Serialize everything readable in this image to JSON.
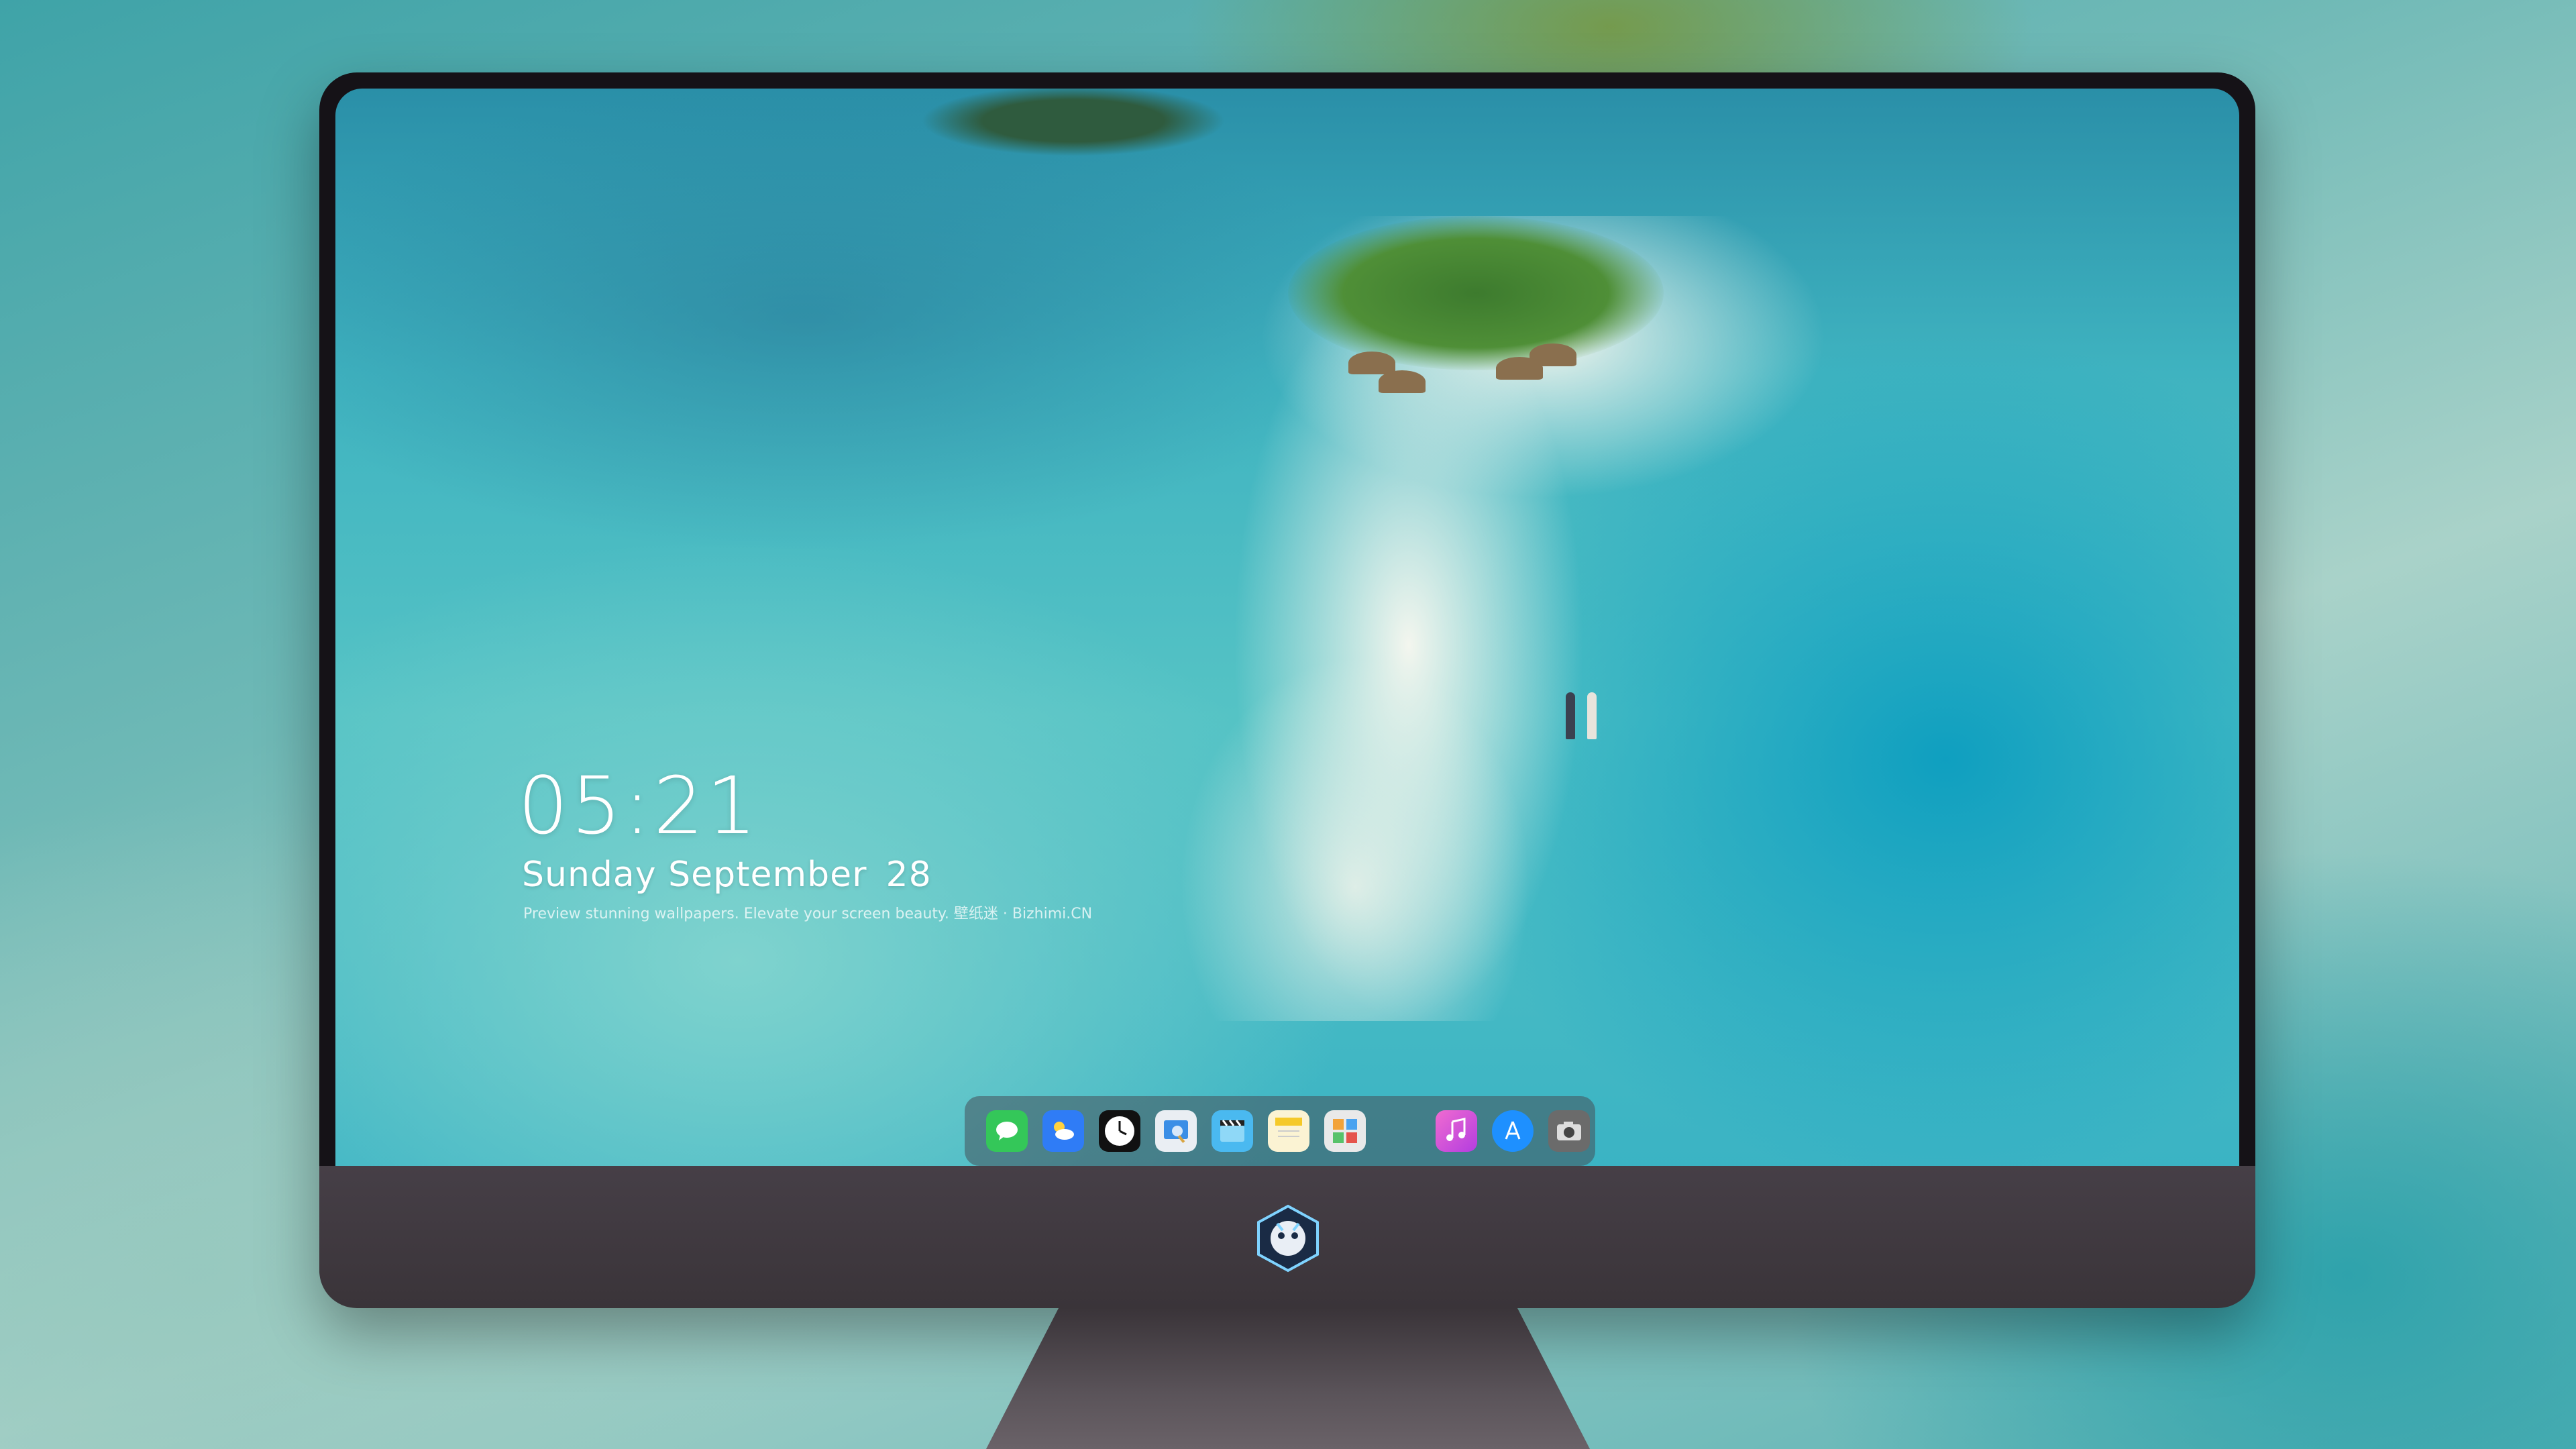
{
  "lockscreen": {
    "time": "05:21",
    "weekday_month": "Sunday September",
    "day": "28",
    "tagline": "Preview stunning wallpapers. Elevate your screen beauty. 壁纸迷 · Bizhimi.CN"
  },
  "dock": {
    "apps": [
      {
        "name": "messages",
        "icon": "speech-bubble",
        "color": "#34c759"
      },
      {
        "name": "weather",
        "icon": "cloud",
        "color": "#2f7cf6"
      },
      {
        "name": "clock",
        "icon": "clock",
        "color": "#111111"
      },
      {
        "name": "preview",
        "icon": "photo-viewer",
        "color": "#3a8ee6"
      },
      {
        "name": "video",
        "icon": "clapperboard",
        "color": "#4ab9f0"
      },
      {
        "name": "notes",
        "icon": "notepad",
        "color": "#f5c928"
      },
      {
        "name": "photos",
        "icon": "photo-grid",
        "color": "#e9e9e9"
      },
      {
        "name": "music",
        "icon": "music-note",
        "color": "#e34bd1"
      },
      {
        "name": "app-store",
        "icon": "app-store",
        "color": "#1e90ff"
      },
      {
        "name": "camera",
        "icon": "camera",
        "color": "#6b6b6b"
      }
    ]
  }
}
